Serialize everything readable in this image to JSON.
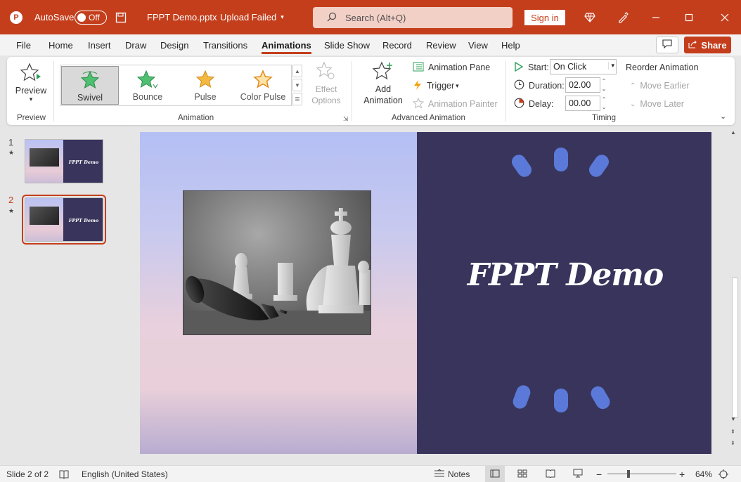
{
  "titlebar": {
    "autosave_label": "AutoSave",
    "autosave_state": "Off",
    "doc_title": "FPPT Demo.pptx",
    "doc_status": "Upload Failed",
    "search_placeholder": "Search (Alt+Q)",
    "signin_label": "Sign in"
  },
  "tabs": [
    "File",
    "Home",
    "Insert",
    "Draw",
    "Design",
    "Transitions",
    "Animations",
    "Slide Show",
    "Record",
    "Review",
    "View",
    "Help"
  ],
  "active_tab": "Animations",
  "share_label": "Share",
  "ribbon": {
    "preview": {
      "button": "Preview",
      "group": "Preview"
    },
    "animation": {
      "group": "Animation",
      "effects": [
        "Swivel",
        "Bounce",
        "Pulse",
        "Color Pulse"
      ],
      "selected_effect": "Swivel",
      "effect_options": "Effect Options"
    },
    "advanced": {
      "group": "Advanced Animation",
      "add_animation": "Add Animation",
      "animation_pane": "Animation Pane",
      "trigger": "Trigger",
      "animation_painter": "Animation Painter"
    },
    "timing": {
      "group": "Timing",
      "start_label": "Start:",
      "start_value": "On Click",
      "duration_label": "Duration:",
      "duration_value": "02.00",
      "delay_label": "Delay:",
      "delay_value": "00.00",
      "reorder_title": "Reorder Animation",
      "move_earlier": "Move Earlier",
      "move_later": "Move Later"
    }
  },
  "slides": [
    {
      "number": "1",
      "title": "FPPT Demo"
    },
    {
      "number": "2",
      "title": "FPPT Demo"
    }
  ],
  "current_slide": {
    "title": "FPPT Demo"
  },
  "statusbar": {
    "slide_info": "Slide 2 of 2",
    "language": "English (United States)",
    "notes_label": "Notes",
    "zoom_level": "64%"
  },
  "colors": {
    "accent": "#c43e1c",
    "slide_dark": "#39345c",
    "slide_accent": "#5b79d8"
  }
}
